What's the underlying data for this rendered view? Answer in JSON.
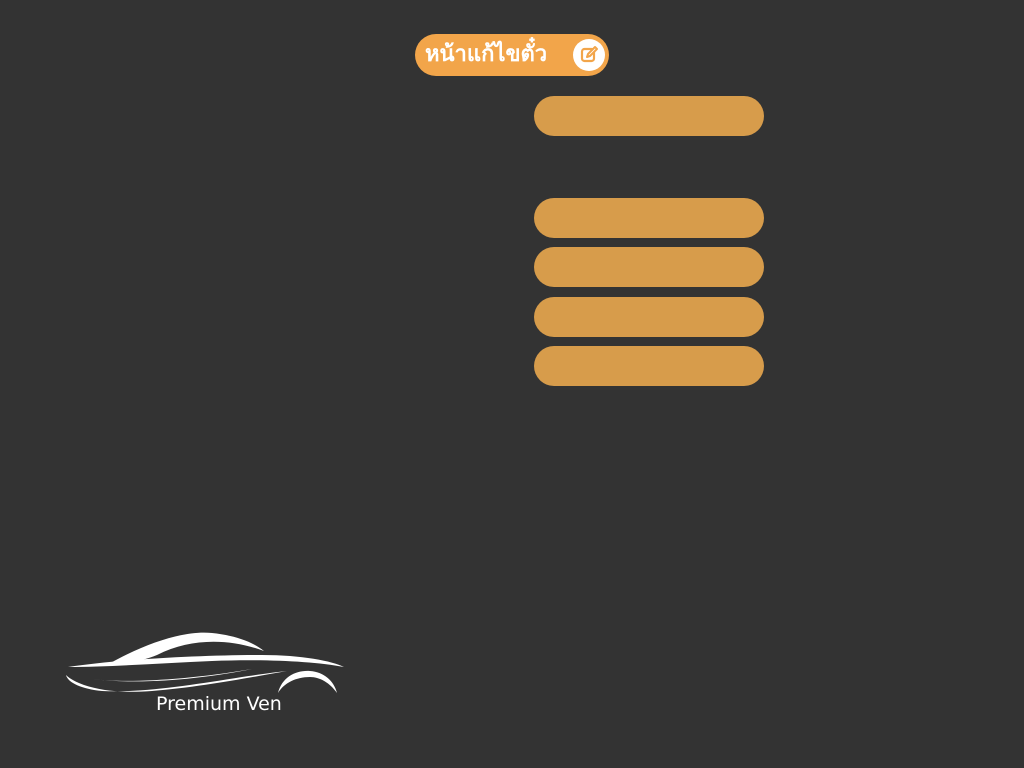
{
  "header": {
    "title": "หน้าแก้ไขตั๋ว",
    "icon": "edit-icon"
  },
  "form": {
    "fields": [
      {
        "name": "field-1",
        "value": ""
      },
      {
        "name": "field-2",
        "value": ""
      },
      {
        "name": "field-3",
        "value": ""
      },
      {
        "name": "field-4",
        "value": ""
      },
      {
        "name": "field-5",
        "value": ""
      }
    ]
  },
  "brand": {
    "name": "Premium Ven",
    "icon": "car-logo-icon"
  },
  "colors": {
    "background": "#333333",
    "title_pill": "#f2a54a",
    "field": "#d79c4b",
    "text": "#ffffff"
  }
}
